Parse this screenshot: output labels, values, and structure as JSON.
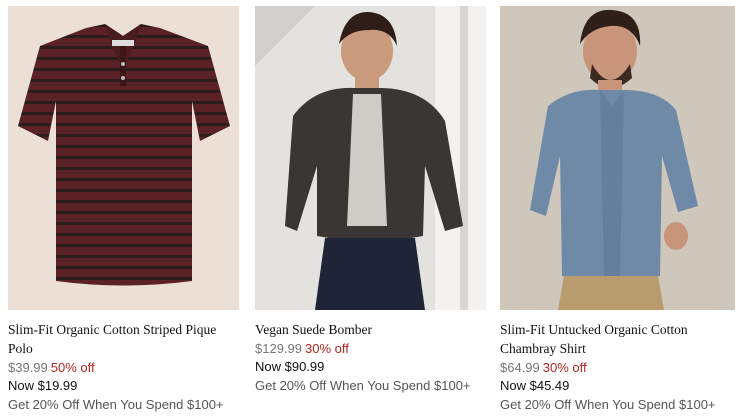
{
  "products": [
    {
      "name": "Slim-Fit Organic Cotton Striped Pique Polo",
      "original_price": "$39.99",
      "discount": "50% off",
      "now_price": "Now $19.99",
      "promo": "Get 20% Off When You Spend $100+"
    },
    {
      "name": "Vegan Suede Bomber",
      "original_price": "$129.99",
      "discount": "30% off",
      "now_price": "Now $90.99",
      "promo": "Get 20% Off When You Spend $100+"
    },
    {
      "name": "Slim-Fit Untucked Organic Cotton Chambray Shirt",
      "original_price": "$64.99",
      "discount": "30% off",
      "now_price": "Now $45.49",
      "promo": "Get 20% Off When You Spend $100+"
    }
  ],
  "colors": {
    "discount": "#b3261e",
    "original_price": "#777777",
    "promo": "#555555"
  }
}
